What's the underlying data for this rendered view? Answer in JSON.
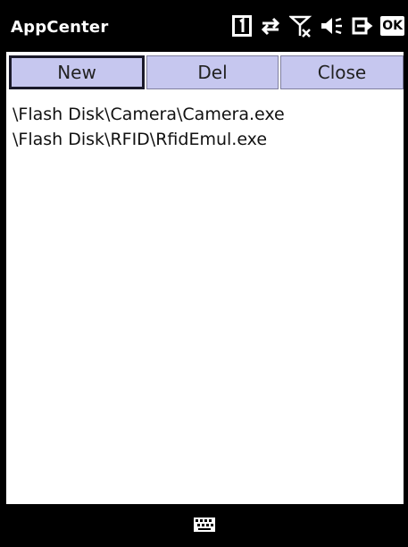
{
  "window": {
    "title": "AppCenter"
  },
  "status": {
    "icons": [
      "sim-slot-1-icon",
      "data-sync-arrows-icon",
      "no-signal-icon",
      "volume-icon",
      "power-plug-icon",
      "ok-icon"
    ],
    "ok_label": "OK"
  },
  "toolbar": {
    "new_label": "New",
    "del_label": "Del",
    "close_label": "Close"
  },
  "files": [
    "\\Flash Disk\\Camera\\Camera.exe",
    "\\Flash Disk\\RFID\\RfidEmul.exe"
  ],
  "bottom": {
    "icon": "keyboard-icon"
  },
  "colors": {
    "button_bg": "#c6c7ef",
    "chrome": "#000000",
    "client": "#ffffff"
  }
}
